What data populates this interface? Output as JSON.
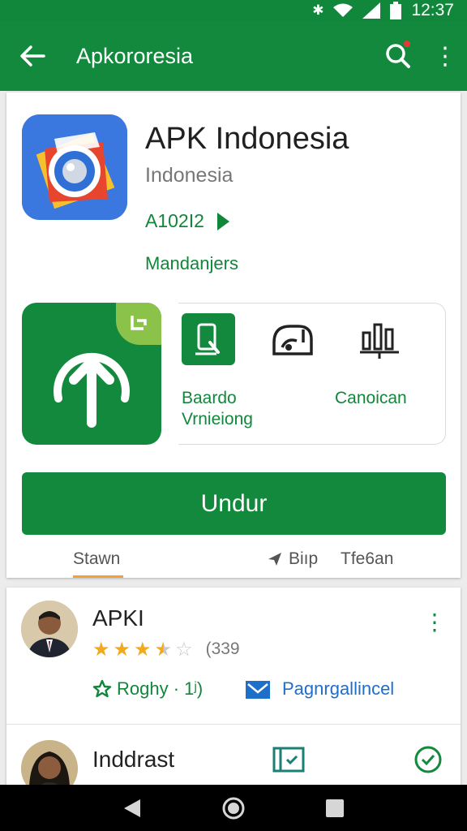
{
  "status_bar": {
    "time": "12:37",
    "icons": [
      "bluetooth-icon",
      "wifi-icon",
      "signal-icon",
      "battery-icon"
    ]
  },
  "app_bar": {
    "title": "Apkororesia",
    "icons": [
      "back-arrow-icon",
      "search-icon",
      "more-vert-icon"
    ]
  },
  "app": {
    "title": "APK Indonesia",
    "subtitle": "Indonesia",
    "version": "A102I2",
    "developer": "Mandanjers"
  },
  "features": [
    {
      "label_line1": "Baardo",
      "label_line2": "Vrnieiong",
      "icon": "phone-touch-icon"
    },
    {
      "label": "",
      "icon": "router-icon"
    },
    {
      "label": "Canoican",
      "icon": "chart-icon"
    }
  ],
  "download_button": {
    "label": "Undur"
  },
  "tabs": [
    {
      "label": "Stawn",
      "active": true
    },
    {
      "label": "Biıp",
      "icon": "send-icon",
      "active": false
    },
    {
      "label": "Tfe6an",
      "active": false
    }
  ],
  "reviews": [
    {
      "name": "APKI",
      "rating": 3.5,
      "rating_count": "(339",
      "action_text": "Roghy · 1ʲ)",
      "link_text": "Pagnrgallincel"
    },
    {
      "name": "Inddrast"
    }
  ],
  "colors": {
    "primary": "#13893d",
    "accent": "#8bc34a",
    "star": "#f2a91b",
    "link": "#1e6fc9",
    "tab_underline": "#f4a13a"
  }
}
